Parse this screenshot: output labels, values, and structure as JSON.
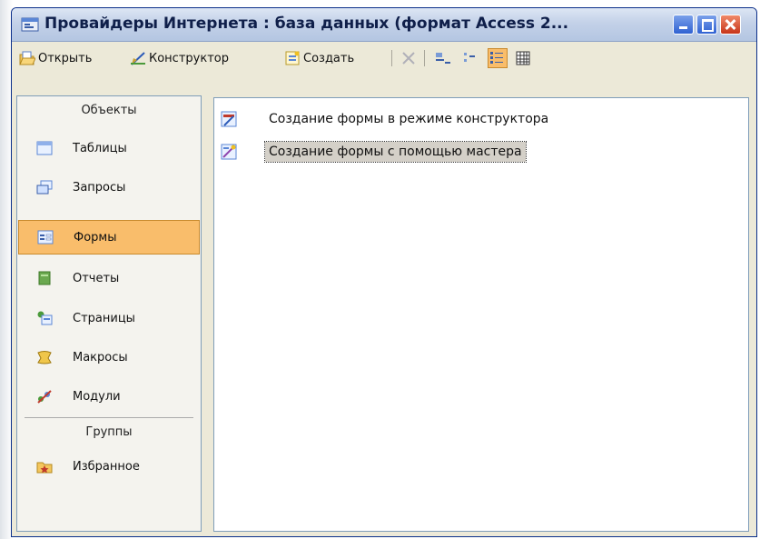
{
  "window": {
    "title": "Провайдеры Интернета : база данных (формат Access 2..."
  },
  "toolbar": {
    "open_label": "Открыть",
    "designer_label": "Конструктор",
    "create_label": "Создать"
  },
  "sidebar": {
    "objects_header": "Объекты",
    "items": [
      {
        "label": "Таблицы",
        "icon": "table-icon"
      },
      {
        "label": "Запросы",
        "icon": "query-icon"
      },
      {
        "label": "Формы",
        "icon": "form-icon"
      },
      {
        "label": "Отчеты",
        "icon": "report-icon"
      },
      {
        "label": "Страницы",
        "icon": "page-icon"
      },
      {
        "label": "Макросы",
        "icon": "macro-icon"
      },
      {
        "label": "Модули",
        "icon": "module-icon"
      }
    ],
    "selected": "Формы",
    "groups_header": "Группы",
    "groups": [
      {
        "label": "Избранное",
        "icon": "favorites-icon"
      }
    ]
  },
  "list": {
    "items": [
      {
        "label": "Создание формы в режиме конструктора",
        "icon": "design-form-icon"
      },
      {
        "label": "Создание формы с помощью мастера",
        "icon": "wizard-form-icon"
      }
    ]
  },
  "colors": {
    "selected_bg": "#f9bd6b",
    "titlebar": "#c3d1e8",
    "window_bg": "#ece9d8"
  }
}
